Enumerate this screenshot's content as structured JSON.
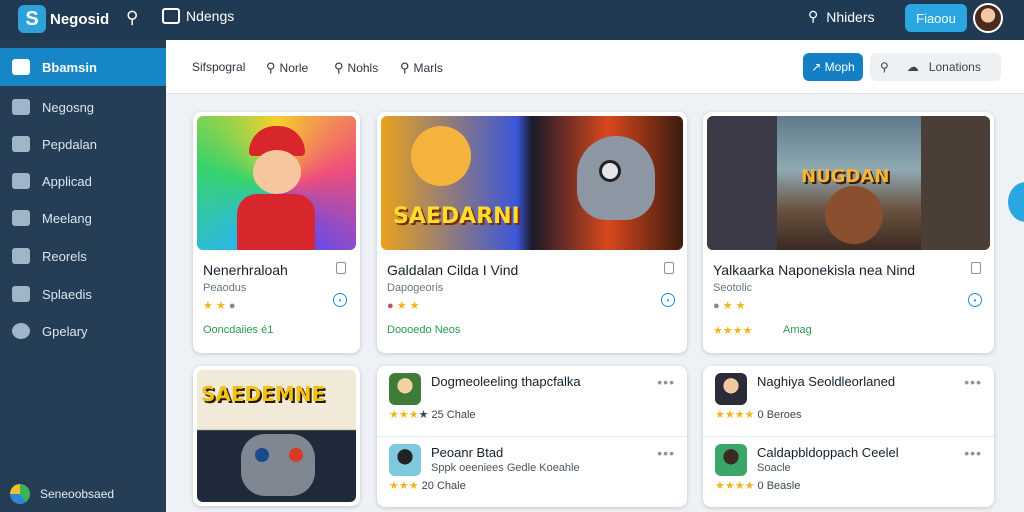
{
  "topbar": {
    "app_name": "Negosid",
    "nav_label": "Ndengs",
    "search_label": "Nhiders",
    "button_label": "Fiaoou",
    "colors": {
      "bar": "#1f3a52",
      "accent": "#2aa6e0"
    }
  },
  "sidebar": {
    "items": [
      {
        "label": "Bbamsin",
        "icon": "grid-icon",
        "active": true
      },
      {
        "label": "Negosng",
        "icon": "card-icon"
      },
      {
        "label": "Pepdalan",
        "icon": "document-icon"
      },
      {
        "label": "Applicad",
        "icon": "arrow-icon"
      },
      {
        "label": "Meelang",
        "icon": "edit-icon"
      },
      {
        "label": "Reorels",
        "icon": "chart-icon"
      },
      {
        "label": "Splaedis",
        "icon": "cloud-icon"
      },
      {
        "label": "Gpelary",
        "icon": "settings-icon"
      }
    ],
    "footer_label": "Seneoobsaed"
  },
  "filters": {
    "items": [
      "Sifspogral",
      "Norle",
      "Nohls",
      "Marls"
    ],
    "report_button": "Moph",
    "search_icon": "search-icon",
    "cloud_icon": "cloud-icon",
    "pill_label": "Lonations"
  },
  "cards": [
    {
      "title": "Nenerhraloah",
      "subtitle": "Peaodus",
      "meta": "Ooncdaiies  é1"
    },
    {
      "title": "Galdalan Cilda I Vind",
      "subtitle": "Dapogeoris",
      "meta": "Doooedo  Neos",
      "banner": "SAEDARNI"
    },
    {
      "title": "Yalkaarka Naponekisla nea Nind",
      "subtitle": "Seotolic",
      "meta": "Amag",
      "banner": "NUGDAN"
    }
  ],
  "poster": {
    "banner": "SAEDEMNE"
  },
  "lists": [
    [
      {
        "title": "Dogmeoleeling thapcfalka",
        "subtitle": "",
        "rating": "25  Chale"
      },
      {
        "title": "Peoanr Btad",
        "subtitle": "Sppk oeeniees  Gedle Koeahle",
        "rating": "20  Chale"
      }
    ],
    [
      {
        "title": "Naghiya Seoldleorlaned",
        "subtitle": "",
        "rating": "0  Beroes"
      },
      {
        "title": "Caldapbldoppach Ceelel",
        "subtitle": "Soacle",
        "rating": "0  Beasle"
      }
    ]
  ]
}
